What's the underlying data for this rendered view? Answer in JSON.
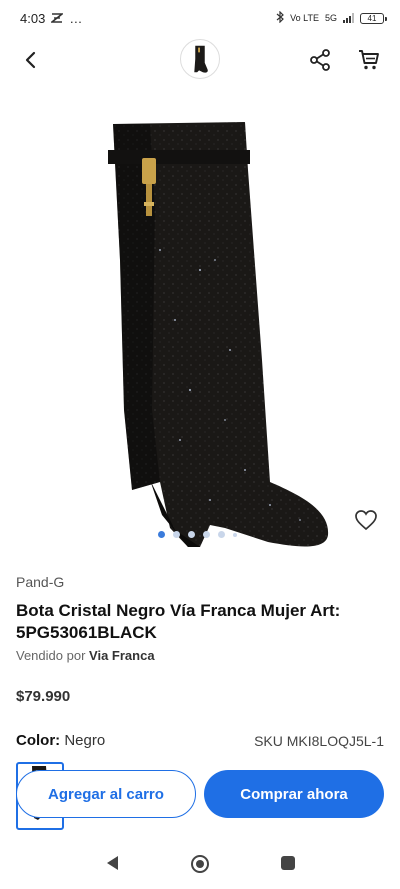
{
  "status_bar": {
    "time": "4:03",
    "extra_icons": "…",
    "network_label": "Vo LTE",
    "network_type": "5G",
    "battery": "41"
  },
  "app_bar": {
    "back_icon": "chevron-left-icon",
    "share_icon": "share-icon",
    "cart_icon": "cart-icon"
  },
  "product": {
    "image_dots": {
      "count": 5,
      "active_index": 0
    },
    "brand": "Pand-G",
    "title": "Bota Cristal Negro Vía Franca Mujer Art: 5PG53061BLACK",
    "seller_prefix": "Vendido por",
    "seller_name": "Via Franca",
    "price": "$79.990",
    "color_label": "Color:",
    "color_value": "Negro",
    "sku": "SKU MKI8LOQJ5L-1"
  },
  "actions": {
    "add_to_cart": "Agregar al carro",
    "buy_now": "Comprar ahora"
  },
  "colors": {
    "accent": "#1f6fe5"
  }
}
